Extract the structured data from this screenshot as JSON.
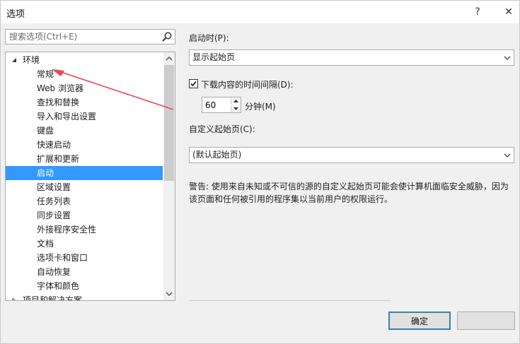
{
  "window": {
    "title": "选项",
    "help_glyph": "?",
    "close_glyph": "✕"
  },
  "search": {
    "placeholder": "搜索选项(Ctrl+E)"
  },
  "tree": {
    "root_label": "环境",
    "items": [
      "常规",
      "Web 浏览器",
      "查找和替换",
      "导入和导出设置",
      "键盘",
      "快速启动",
      "扩展和更新",
      "启动",
      "区域设置",
      "任务列表",
      "同步设置",
      "外接程序安全性",
      "文档",
      "选项卡和窗口",
      "自动恢复",
      "字体和颜色"
    ],
    "selected": "启动",
    "partial_next_root": "项目和解决方案"
  },
  "settings": {
    "startup_label": "启动时(P):",
    "startup_value": "显示起始页",
    "download_checkbox_label": "下载内容的时间间隔(D):",
    "download_checked": true,
    "interval_value": "60",
    "interval_unit": "分钟(M)",
    "custom_start_label": "自定义起始页(C):",
    "custom_start_value": "(默认起始页)",
    "warning_text": "警告: 使用来自未知或不可信的源的自定义起始页可能会使计算机面临安全威胁，因为该页面和任何被引用的程序集以当前用户的权限运行。"
  },
  "buttons": {
    "ok_label": "确定"
  },
  "colors": {
    "selection": "#3399ff",
    "annotation_arrow": "#e8484f",
    "ok_border": "#3c7fb1"
  }
}
